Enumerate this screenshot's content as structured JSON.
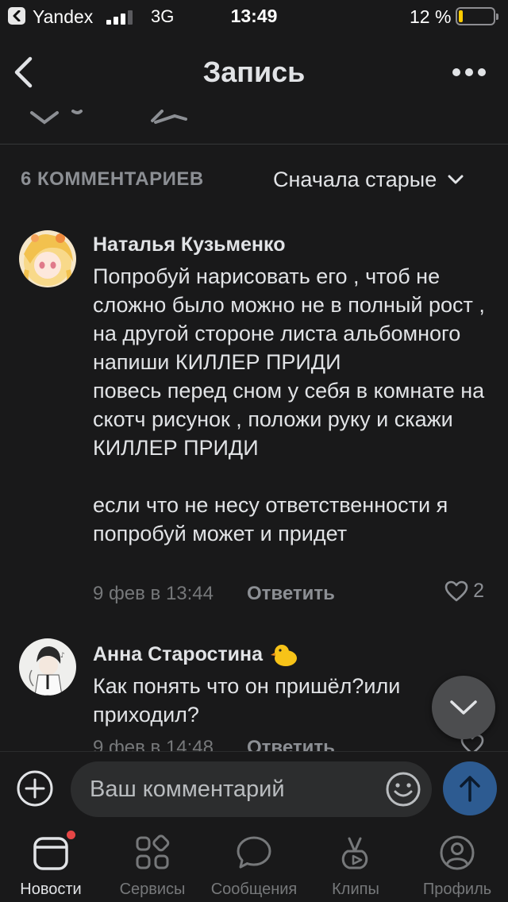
{
  "status_bar": {
    "back_app": "Yandex",
    "network": "3G",
    "time": "13:49",
    "battery_percent_label": "12 %",
    "battery_level": 0.12,
    "signal_bars_filled": 3
  },
  "header": {
    "title": "Запись",
    "back_icon": "chevron-left-icon",
    "more_icon": "more-horizontal-icon"
  },
  "comments_section": {
    "count_label": "6 КОММЕНТАРИЕВ",
    "sort_label": "Сначала старые"
  },
  "comments": [
    {
      "author": "Наталья Кузьменко",
      "text": "Попробуй нарисовать его , чтоб не сложно было можно не в полный рост , на другой стороне листа альбомного напиши КИЛЛЕР ПРИДИ\nповесь перед сном у себя в комнате на скотч рисунок , положи руку и скажи КИЛЛЕР ПРИДИ\n\nесли что не несу ответственности я попробуй может и придет",
      "date": "9 фев в 13:44",
      "reply_label": "Ответить",
      "likes": "2"
    },
    {
      "author": "Анна Старостина",
      "author_emoji": "duck-emoji",
      "text": "Как понять что он пришёл?или приходил?",
      "date": "9 фев в 14:48",
      "reply_label": "Ответить"
    }
  ],
  "composer": {
    "placeholder": "Ваш комментарий"
  },
  "tabbar": {
    "tabs": [
      {
        "label": "Новости",
        "icon": "news-icon",
        "active": true,
        "badge": true
      },
      {
        "label": "Сервисы",
        "icon": "services-icon"
      },
      {
        "label": "Сообщения",
        "icon": "messages-icon"
      },
      {
        "label": "Клипы",
        "icon": "clips-icon"
      },
      {
        "label": "Профиль",
        "icon": "profile-icon"
      }
    ]
  },
  "colors": {
    "background": "#19191a",
    "text_primary": "#e1e3e6",
    "text_secondary": "#76787a",
    "accent_send": "#2d5b91",
    "battery": "#ffcc00",
    "badge": "#e64646"
  }
}
